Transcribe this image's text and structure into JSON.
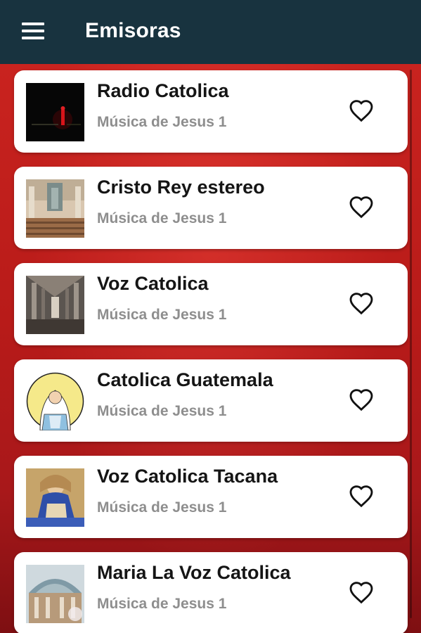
{
  "appbar": {
    "title": "Emisoras",
    "menu_icon": "hamburger-menu-icon",
    "background": "#18333f"
  },
  "stations": [
    {
      "name": "Radio Catolica",
      "subtitle": "Música de Jesus 1",
      "favorite_icon": "heart-outline-icon"
    },
    {
      "name": "Cristo Rey estereo",
      "subtitle": "Música de Jesus 1",
      "favorite_icon": "heart-outline-icon"
    },
    {
      "name": "Voz Catolica",
      "subtitle": "Música de Jesus 1",
      "favorite_icon": "heart-outline-icon"
    },
    {
      "name": "Catolica Guatemala",
      "subtitle": "Música de Jesus 1",
      "favorite_icon": "heart-outline-icon"
    },
    {
      "name": "Voz Catolica Tacana",
      "subtitle": "Música de Jesus 1",
      "favorite_icon": "heart-outline-icon"
    },
    {
      "name": "Maria La Voz Catolica",
      "subtitle": "Música de Jesus 1",
      "favorite_icon": "heart-outline-icon"
    }
  ],
  "colors": {
    "background_red": "#b81b19",
    "card": "#ffffff",
    "title_text": "#151515",
    "subtitle_text": "#8e8e8e"
  }
}
